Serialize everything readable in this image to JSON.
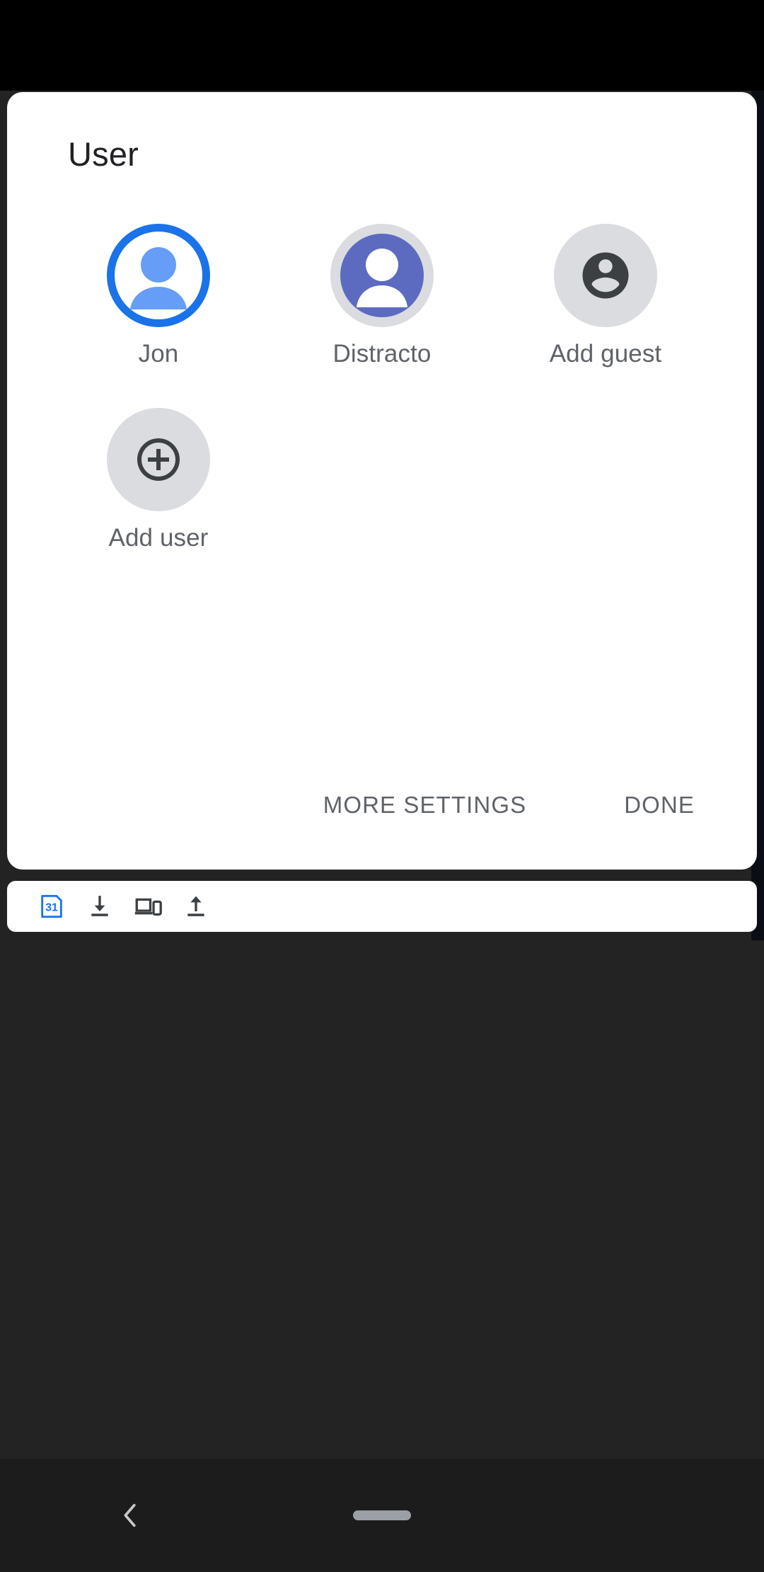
{
  "dialog": {
    "title": "User",
    "users": [
      {
        "label": "Jon",
        "avatar": "person-filled-avatar",
        "state": "active"
      },
      {
        "label": "Distracto",
        "avatar": "person-filled-avatar",
        "state": "inactive"
      },
      {
        "label": "Add guest",
        "avatar": "account-circle-icon",
        "state": "action"
      },
      {
        "label": "Add user",
        "avatar": "plus-circle-icon",
        "state": "action"
      }
    ],
    "actions": {
      "more_settings_label": "MORE SETTINGS",
      "done_label": "DONE"
    }
  },
  "toolbar": {
    "icons": [
      {
        "name": "calendar-31-icon",
        "label": "31"
      },
      {
        "name": "download-icon",
        "label": ""
      },
      {
        "name": "cast-devices-icon",
        "label": ""
      },
      {
        "name": "upload-icon",
        "label": ""
      }
    ]
  },
  "navbar": {
    "back_label": "",
    "home_label": ""
  },
  "colors": {
    "accent_blue": "#1a73e8",
    "avatar_light_blue": "#669df6",
    "avatar_indigo": "#5c6bc0",
    "avatar_grey": "#dadce0",
    "icon_dark": "#3c4043",
    "label_grey": "#5f6368",
    "title_dark": "#202124",
    "card_white": "#ffffff",
    "page_dark": "#232323",
    "navbar_dark": "#1c1c1c",
    "nav_handle": "#9aa0a6"
  }
}
